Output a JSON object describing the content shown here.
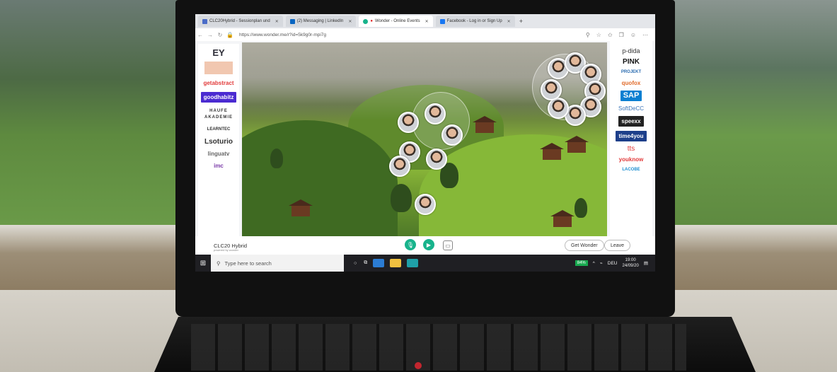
{
  "browser": {
    "tabs": [
      {
        "label": "CLC20Hybrid - Sessionplan und",
        "active": false
      },
      {
        "label": "(2) Messaging | LinkedIn",
        "active": false
      },
      {
        "label": "Wonder - Online Events",
        "active": true
      },
      {
        "label": "Facebook - Log in or Sign Up",
        "active": false
      }
    ],
    "new_tab": "+",
    "url": "https://www.wonder.me/r?id=5k9g0r-mpi7g"
  },
  "sponsors_left": [
    "EY",
    "getabstract",
    "goodhabitz",
    "HAUFE AKADEMIE",
    "LEARNTEC",
    "Lsoturio",
    "linguatv",
    "imc"
  ],
  "sponsors_right": [
    "p-dida",
    "PINK",
    "PROJEKT",
    "quofox",
    "SAP",
    "SoftDeCC",
    "speexx",
    "time4you",
    "tts",
    "youknow",
    "LACOBE"
  ],
  "room": {
    "name": "CLC20 Hybrid",
    "powered_by": "powered by wonder"
  },
  "buttons": {
    "get_wonder": "Get Wonder",
    "leave": "Leave"
  },
  "taskbar": {
    "search_placeholder": "Type here to search",
    "battery": "84%",
    "language": "DEU",
    "time": "19:00",
    "date": "24/09/20"
  },
  "colors": {
    "accent": "#18b38c",
    "taskbar": "#1f1f23",
    "battery": "#18a94f"
  }
}
